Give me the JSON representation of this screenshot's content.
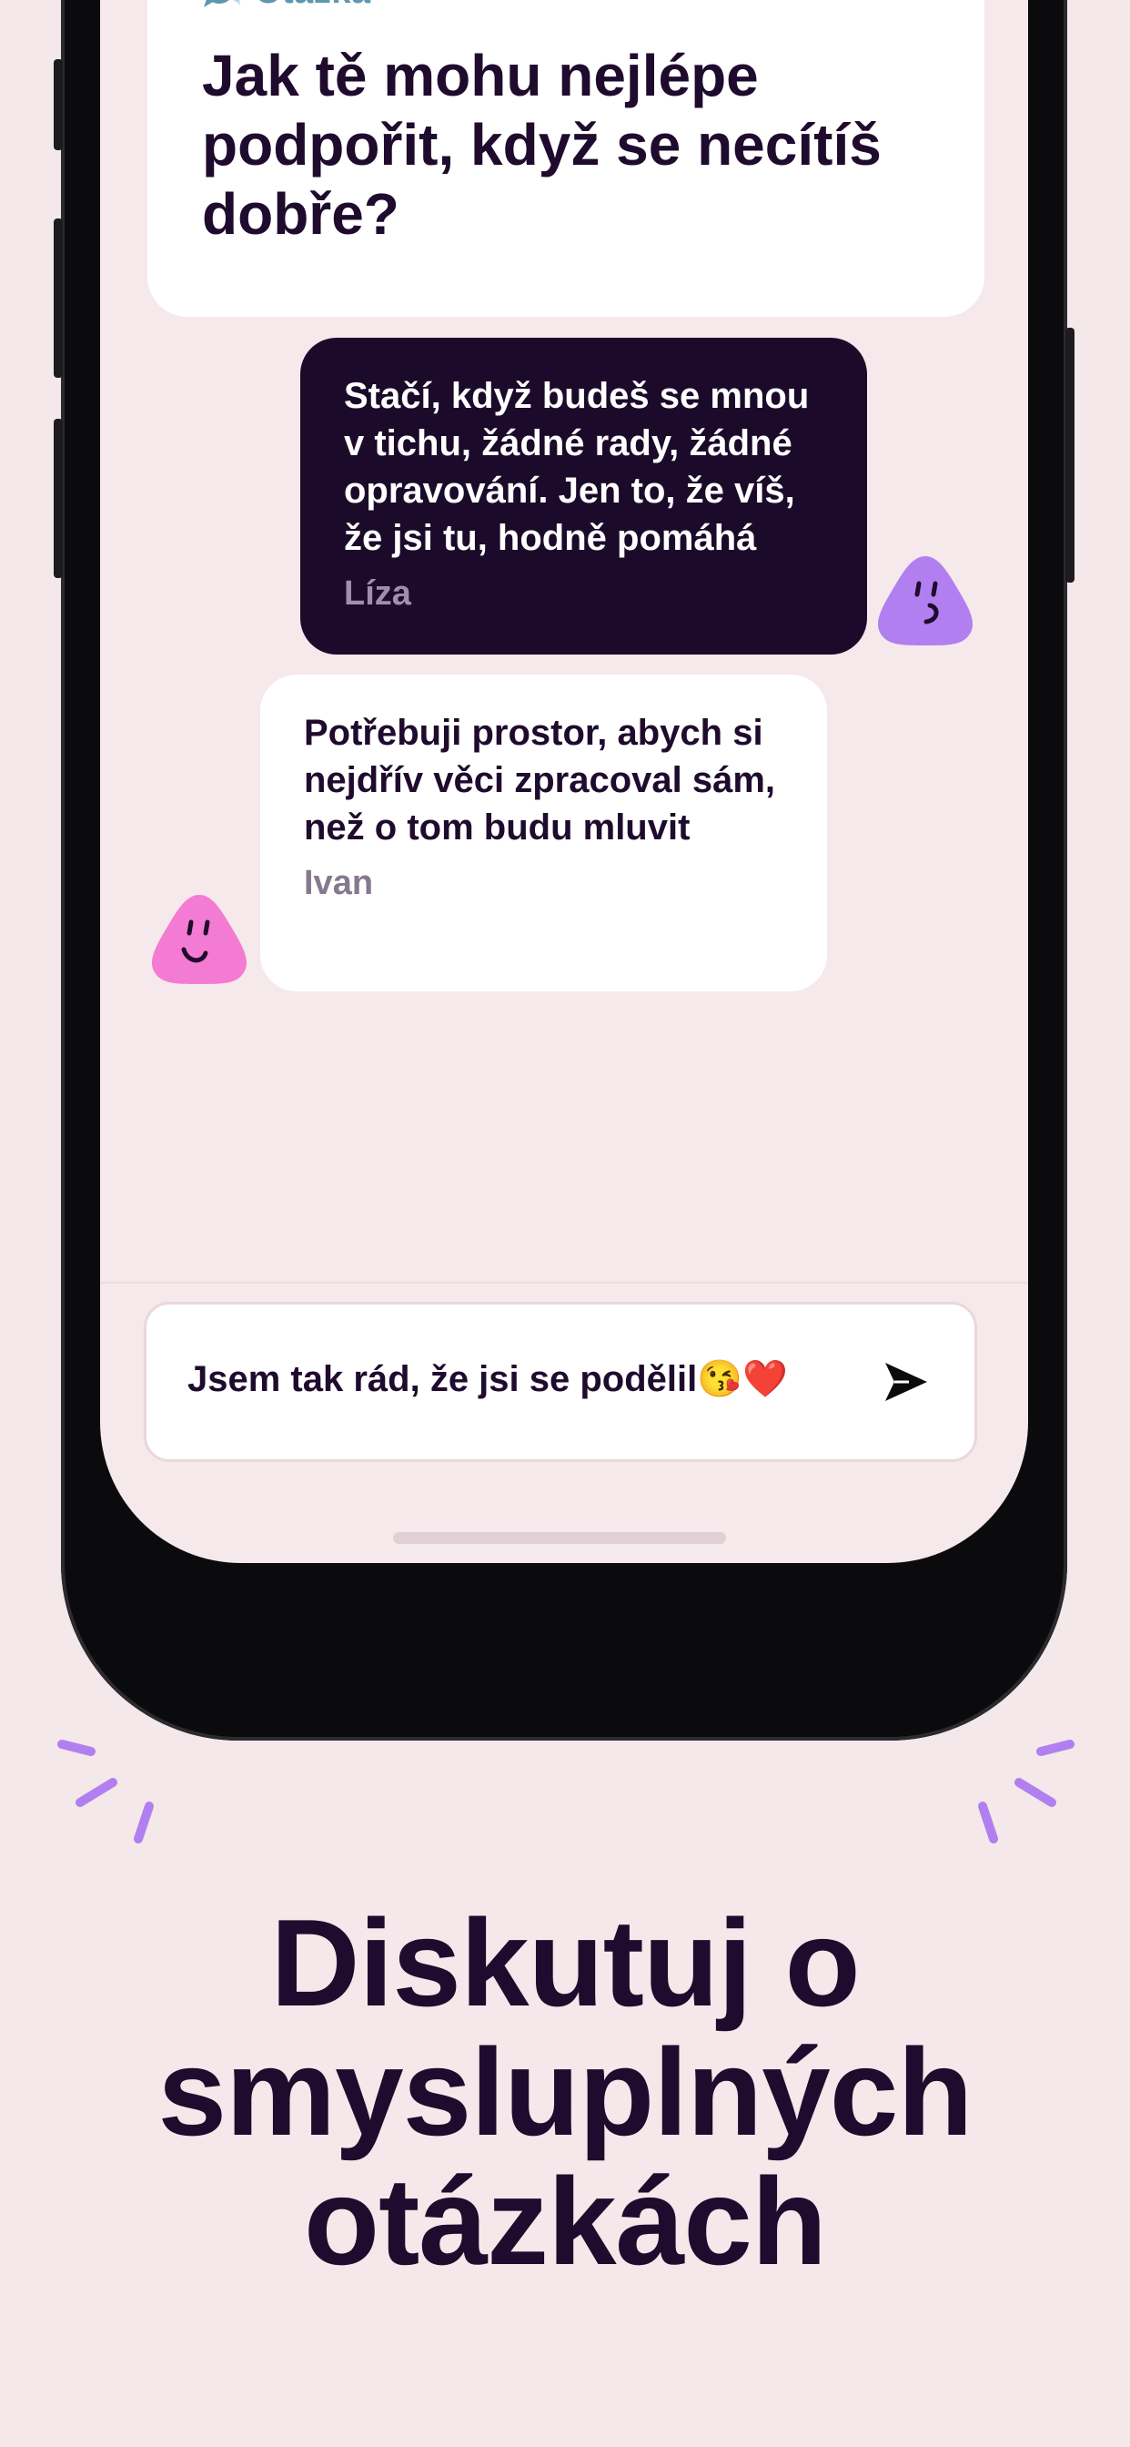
{
  "question": {
    "label": "Otázka",
    "text": "Jak tě mohu nejlépe podpořit, když se necítíš dobře?"
  },
  "messages": [
    {
      "text": "Stačí, když budeš se mnou v tichu, žádné rady, žádné opravování. Jen to, že víš, že jsi tu, hodně pomáhá",
      "author": "Líza"
    },
    {
      "text": "Potřebuji prostor, abych si nejdřív věci zpracoval sám, než o tom budu mluvit",
      "author": "Ivan"
    }
  ],
  "composer": {
    "value": "Jsem tak rád, že jsi se podělil😘❤️"
  },
  "headline": "Diskutuj o smysluplných otázkách",
  "colors": {
    "background": "#f4e8ea",
    "ink": "#1f0b2d",
    "accent_blue": "#5d98b0",
    "avatar_purple": "#b27ff0",
    "avatar_pink": "#f47bd3",
    "dark_bubble": "#1c0a2a",
    "sparkle_purple": "#b27ff0"
  },
  "icons": {
    "question": "speech-bubbles-icon",
    "send": "send-arrow-icon",
    "avatar": "blob-smiley-icon"
  }
}
